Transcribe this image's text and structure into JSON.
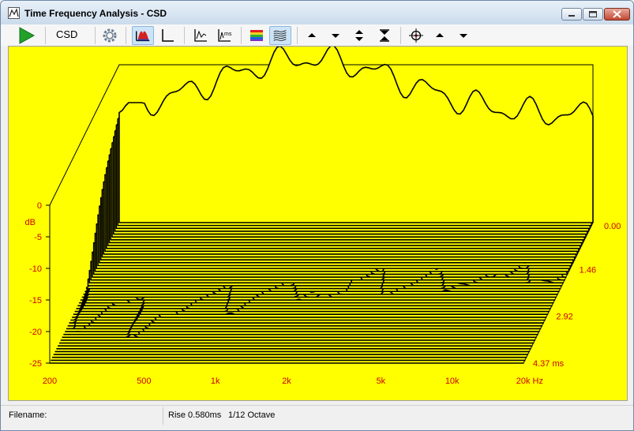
{
  "window": {
    "title": "Time Frequency Analysis - CSD"
  },
  "toolbar": {
    "csd_label": "CSD",
    "icons": [
      "run-icon",
      "csd-label",
      "settings-icon",
      "waterfall-view-icon",
      "axes-icon",
      "impulse-icon",
      "ms-impulse-icon",
      "color-palette-icon",
      "surface-icon",
      "arrow-up-icon",
      "arrow-down-icon",
      "expand-icon",
      "collapse-icon",
      "crosshair-icon",
      "arrow-up-icon",
      "arrow-down-icon"
    ]
  },
  "chart_data": {
    "type": "area",
    "title": "",
    "ylabel": "dB",
    "y_ticks": [
      "0",
      "-5",
      "-10",
      "-15",
      "-20",
      "-25"
    ],
    "x_ticks": [
      "200",
      "500",
      "1k",
      "2k",
      "5k",
      "10k",
      "20k Hz"
    ],
    "z_ticks": [
      "0.00",
      "1.46",
      "2.92",
      "4.37 ms"
    ],
    "ylim": [
      -25,
      0
    ],
    "xlim_hz": [
      200,
      20000
    ],
    "zlim_ms": [
      0,
      4.37
    ],
    "x_scale": "log",
    "slices": 50,
    "background": "#ffff00",
    "line_color": "#000000",
    "label_color": "#cc0000"
  },
  "status": {
    "filename_label": "Filename:",
    "rise": "Rise 0.580ms",
    "octave": "1/12 Octave"
  }
}
